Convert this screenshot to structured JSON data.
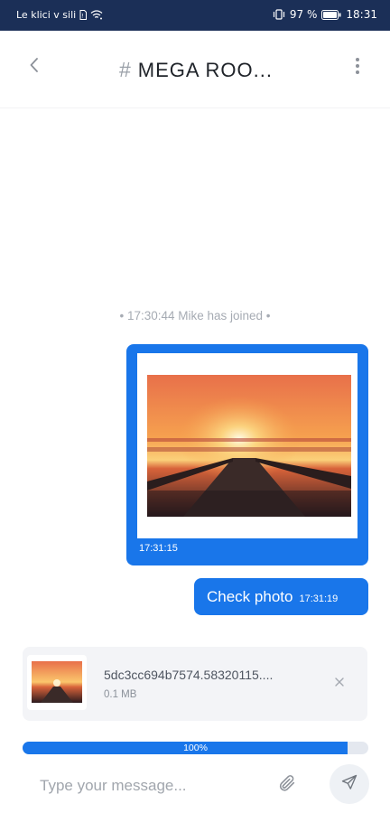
{
  "status_bar": {
    "carrier": "Le klici v sili",
    "battery_percent": "97 %",
    "time": "18:31",
    "icons": [
      "sim-icon",
      "wifi-icon",
      "vibrate-icon",
      "battery-icon"
    ],
    "background": "#1b2f57"
  },
  "header": {
    "hash_symbol": "#",
    "title": "MEGA ROO...",
    "icons": [
      "chevron-left-icon",
      "more-vertical-icon"
    ]
  },
  "messages": {
    "system_text": "• 17:30:44 Mike has joined •",
    "image_message": {
      "time": "17:31:15"
    },
    "text_message": {
      "text": "Check photo",
      "time": "17:31:19"
    }
  },
  "attachment": {
    "file_name": "5dc3cc694b7574.58320115....",
    "file_size": "0.1 MB",
    "remove_icon": "close-icon"
  },
  "upload": {
    "label": "100%",
    "progress": 0.94
  },
  "composer": {
    "placeholder": "Type your message...",
    "icons": [
      "paperclip-icon",
      "send-icon"
    ]
  },
  "colors": {
    "accent": "#1976ea",
    "status_bar": "#1b2f57"
  }
}
